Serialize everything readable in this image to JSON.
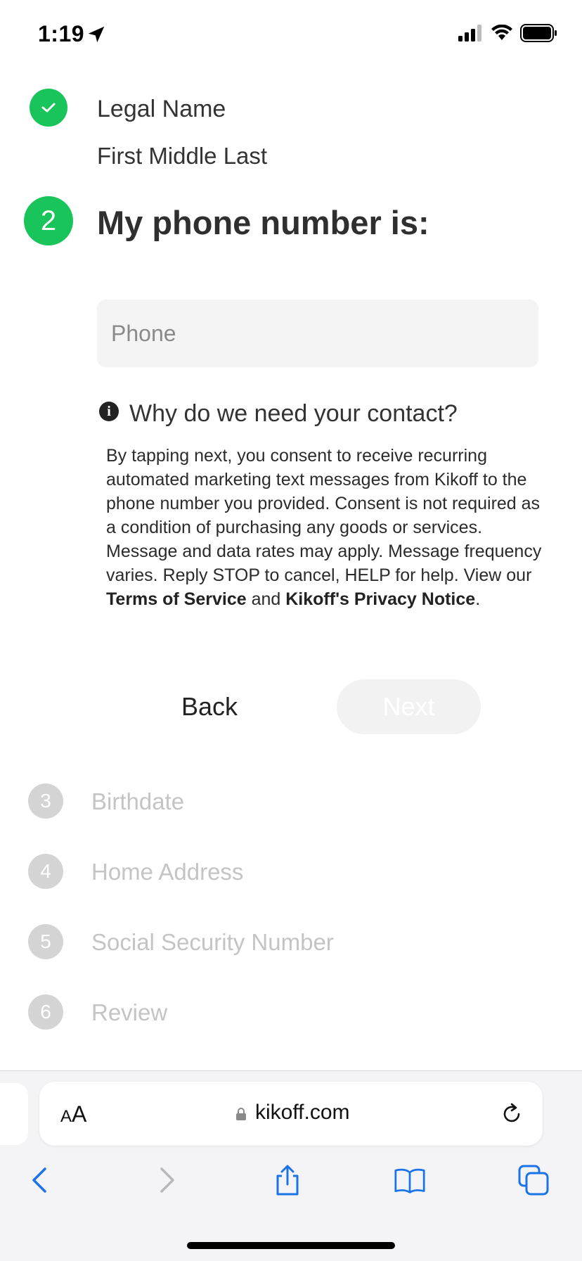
{
  "status_bar": {
    "time": "1:19"
  },
  "steps": {
    "step1": {
      "title": "Legal Name",
      "value": "First Middle Last"
    },
    "step2": {
      "number": "2",
      "title": "My phone number is:"
    },
    "upcoming": [
      {
        "number": "3",
        "label": "Birthdate"
      },
      {
        "number": "4",
        "label": "Home Address"
      },
      {
        "number": "5",
        "label": "Social Security Number"
      },
      {
        "number": "6",
        "label": "Review"
      }
    ]
  },
  "phone": {
    "placeholder": "Phone",
    "value": ""
  },
  "info": {
    "title": "Why do we need your contact?",
    "text_before": "By tapping next, you consent to receive recurring automated marketing text messages from Kikoff to the phone number you provided. Consent is not required as a condition of purchasing any goods or services. Message and data rates may apply. Message frequency varies. Reply STOP to cancel, HELP for help. View our ",
    "terms_link": "Terms of Service",
    "text_and": " and ",
    "privacy_link": "Kikoff's Privacy Notice",
    "text_end": "."
  },
  "buttons": {
    "back": "Back",
    "next": "Next"
  },
  "browser": {
    "aa": "AA",
    "url": "kikoff.com"
  },
  "colors": {
    "accent": "#19c45a",
    "disabled": "#c4c4c4",
    "ios_blue": "#1a73e8"
  }
}
